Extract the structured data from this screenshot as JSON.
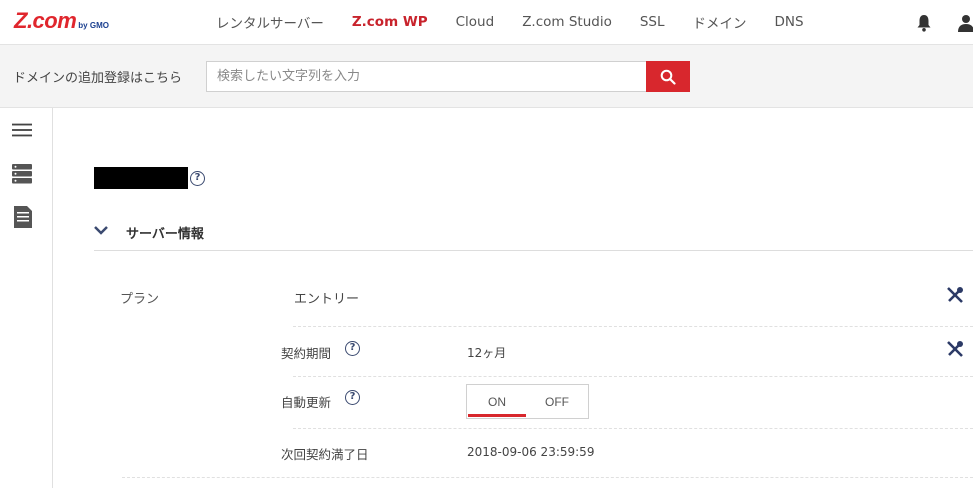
{
  "header": {
    "logo_main": "Z.com",
    "logo_sub": "by GMO",
    "nav": [
      {
        "label": "レンタルサーバー"
      },
      {
        "label": "Z.com WP"
      },
      {
        "label": "Cloud"
      },
      {
        "label": "Z.com Studio"
      },
      {
        "label": "SSL"
      },
      {
        "label": "ドメイン"
      },
      {
        "label": "DNS"
      }
    ],
    "active_nav": "Z.com WP"
  },
  "search": {
    "label": "ドメインの追加登録はこちら",
    "placeholder": "検索したい文字列を入力"
  },
  "sidebar": {
    "icons": [
      "menu-icon",
      "server-icon",
      "document-icon"
    ]
  },
  "main": {
    "server_name_redacted": true,
    "section_title": "サーバー情報",
    "plan": {
      "label": "プラン",
      "value": "エントリー"
    },
    "contract_period": {
      "label": "契約期間",
      "value": "12ヶ月"
    },
    "auto_renew": {
      "label": "自動更新",
      "on_label": "ON",
      "off_label": "OFF",
      "selected": "ON"
    },
    "next_expiry": {
      "label": "次回契約満了日",
      "value": "2018-09-06 23:59:59"
    }
  },
  "colors": {
    "brand_red": "#d8272d",
    "brand_navy": "#3b4a70"
  }
}
